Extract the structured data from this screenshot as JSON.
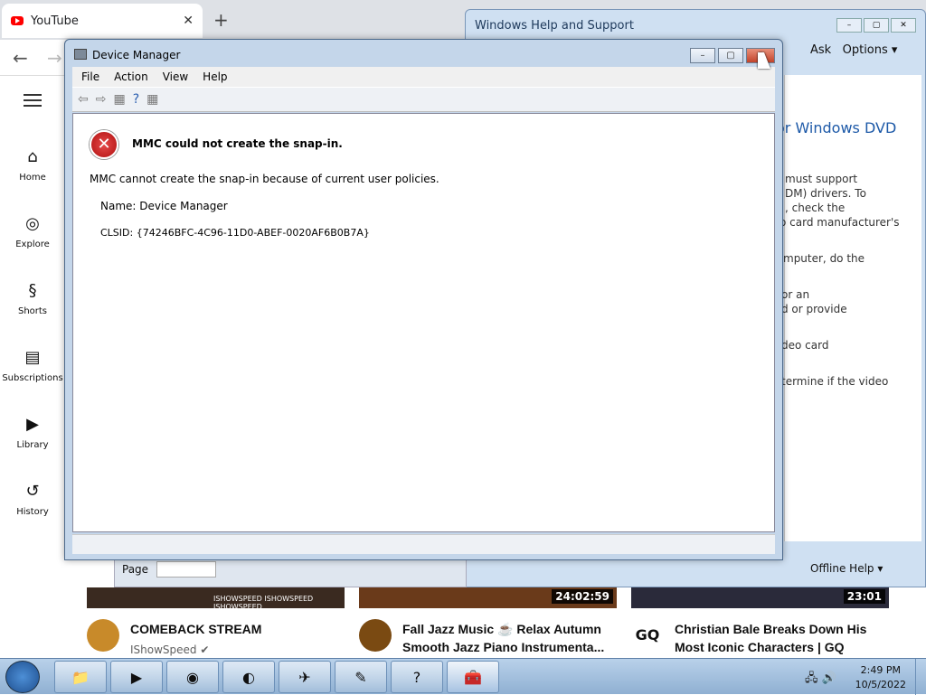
{
  "browser": {
    "tab_title": "YouTube",
    "tab_close": "✕",
    "new_tab": "+",
    "back": "←",
    "forward": "→"
  },
  "youtube": {
    "nav": [
      {
        "label": "Home",
        "icon": "home-icon"
      },
      {
        "label": "Explore",
        "icon": "compass-icon"
      },
      {
        "label": "Shorts",
        "icon": "shorts-icon"
      },
      {
        "label": "Subscriptions",
        "icon": "subscriptions-icon"
      },
      {
        "label": "Library",
        "icon": "library-icon"
      },
      {
        "label": "History",
        "icon": "history-icon"
      }
    ],
    "videos": [
      {
        "title": "COMEBACK STREAM",
        "channel": "IShowSpeed",
        "duration": ""
      },
      {
        "title": "Fall Jazz Music ☕ Relax Autumn Smooth Jazz Piano Instrumenta...",
        "channel": "",
        "duration": "24:02:59"
      },
      {
        "title": "Christian Bale Breaks Down His Most Iconic Characters | GQ",
        "channel": "",
        "duration": "23:01"
      }
    ],
    "thumb_caption": "ISHOWSPEED ISHOWSPEED ISHOWSPEED"
  },
  "help_window": {
    "title": "Windows Help and Support",
    "ask": "Ask",
    "options": "Options",
    "heading_fragment": "or Windows DVD",
    "text_lines": [
      "must support",
      "DM) drivers. To",
      ", check the",
      "o card manufacturer's",
      "mputer, do the",
      "or an",
      "d or provide",
      "deo card",
      "termine if the video"
    ],
    "offline_help": "Offline Help",
    "page_label": "Page"
  },
  "device_manager": {
    "title": "Device Manager",
    "menu": [
      "File",
      "Action",
      "View",
      "Help"
    ],
    "error_title": "MMC could not create the snap-in.",
    "error_message": "MMC cannot create the snap-in because of current user policies.",
    "name_line": "Name: Device Manager",
    "clsid_line": "CLSID: {74246BFC-4C96-11D0-ABEF-0020AF6B0B7A}"
  },
  "taskbar": {
    "time": "2:49 PM",
    "date": "10/5/2022",
    "buttons": [
      "explorer-icon",
      "media-player-icon",
      "chrome-icon",
      "firefox-icon",
      "mail-icon",
      "paint-icon",
      "help-icon",
      "device-manager-icon"
    ]
  },
  "colors": {
    "youtube_red": "#ff0000",
    "win7_taskbar": "#8fb0d2",
    "close_button": "#c2432a"
  }
}
